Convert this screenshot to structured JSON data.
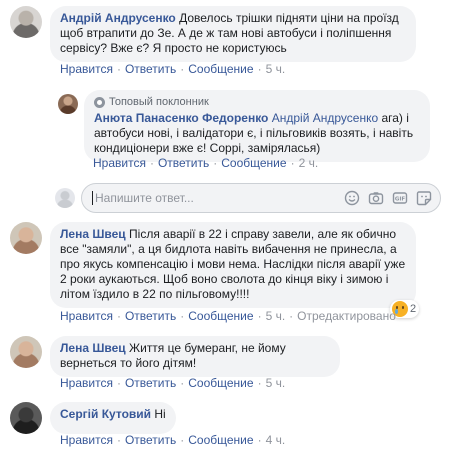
{
  "comments": [
    {
      "author": "Андрій Андрусенко",
      "text": "Довелось трішки підняти ціни на проїзд щоб втрапити до Зе. А де ж там нові автобуси і поліпшення сервісу? Вже є? Я просто не користуюсь",
      "like": "Нравится",
      "reply": "Ответить",
      "message": "Сообщение",
      "time": "5 ч."
    },
    {
      "badge": "Топовый поклонник",
      "author": "Анюта Панасенко Федоренко",
      "tagged": "Андрій Андрусенко",
      "text": "ага) і автобуси нові, і валідатори є, і пільговиків возять, і навіть кондиціонери вже є! Соррі, заміряласья)",
      "like": "Нравится",
      "reply": "Ответить",
      "message": "Сообщение",
      "time": "2 ч."
    },
    {
      "author": "Лена Швец",
      "text": "Після аварії в 22 і справу завели, але як обично все \"замяли\", а ця бидлота навіть вибачення не принесла, а про якусь компенсацію і мови нема. Наслідки після аварії уже 2 роки аукаються. Щоб воно сволота до кінця віку і зимою і літом їздило в 22 по пільговому!!!!",
      "like": "Нравится",
      "reply": "Ответить",
      "message": "Сообщение",
      "time": "5 ч.",
      "edited": "Отредактировано",
      "reaction_count": "2"
    },
    {
      "author": "Лена Швец",
      "text": "Життя це бумеранг, не йому вернеться то його дітям!",
      "like": "Нравится",
      "reply": "Ответить",
      "message": "Сообщение",
      "time": "5 ч."
    },
    {
      "author": "Сергій Кутовий",
      "text": "Ні",
      "like": "Нравится",
      "reply": "Ответить",
      "message": "Сообщение",
      "time": "4 ч."
    }
  ],
  "reply_box": {
    "placeholder": "Напишите ответ...",
    "icons": [
      "emoji-icon",
      "camera-icon",
      "gif-icon",
      "sticker-icon"
    ]
  },
  "colors": {
    "link": "#385898",
    "bubble": "#f2f3f5",
    "meta": "#90949c"
  }
}
